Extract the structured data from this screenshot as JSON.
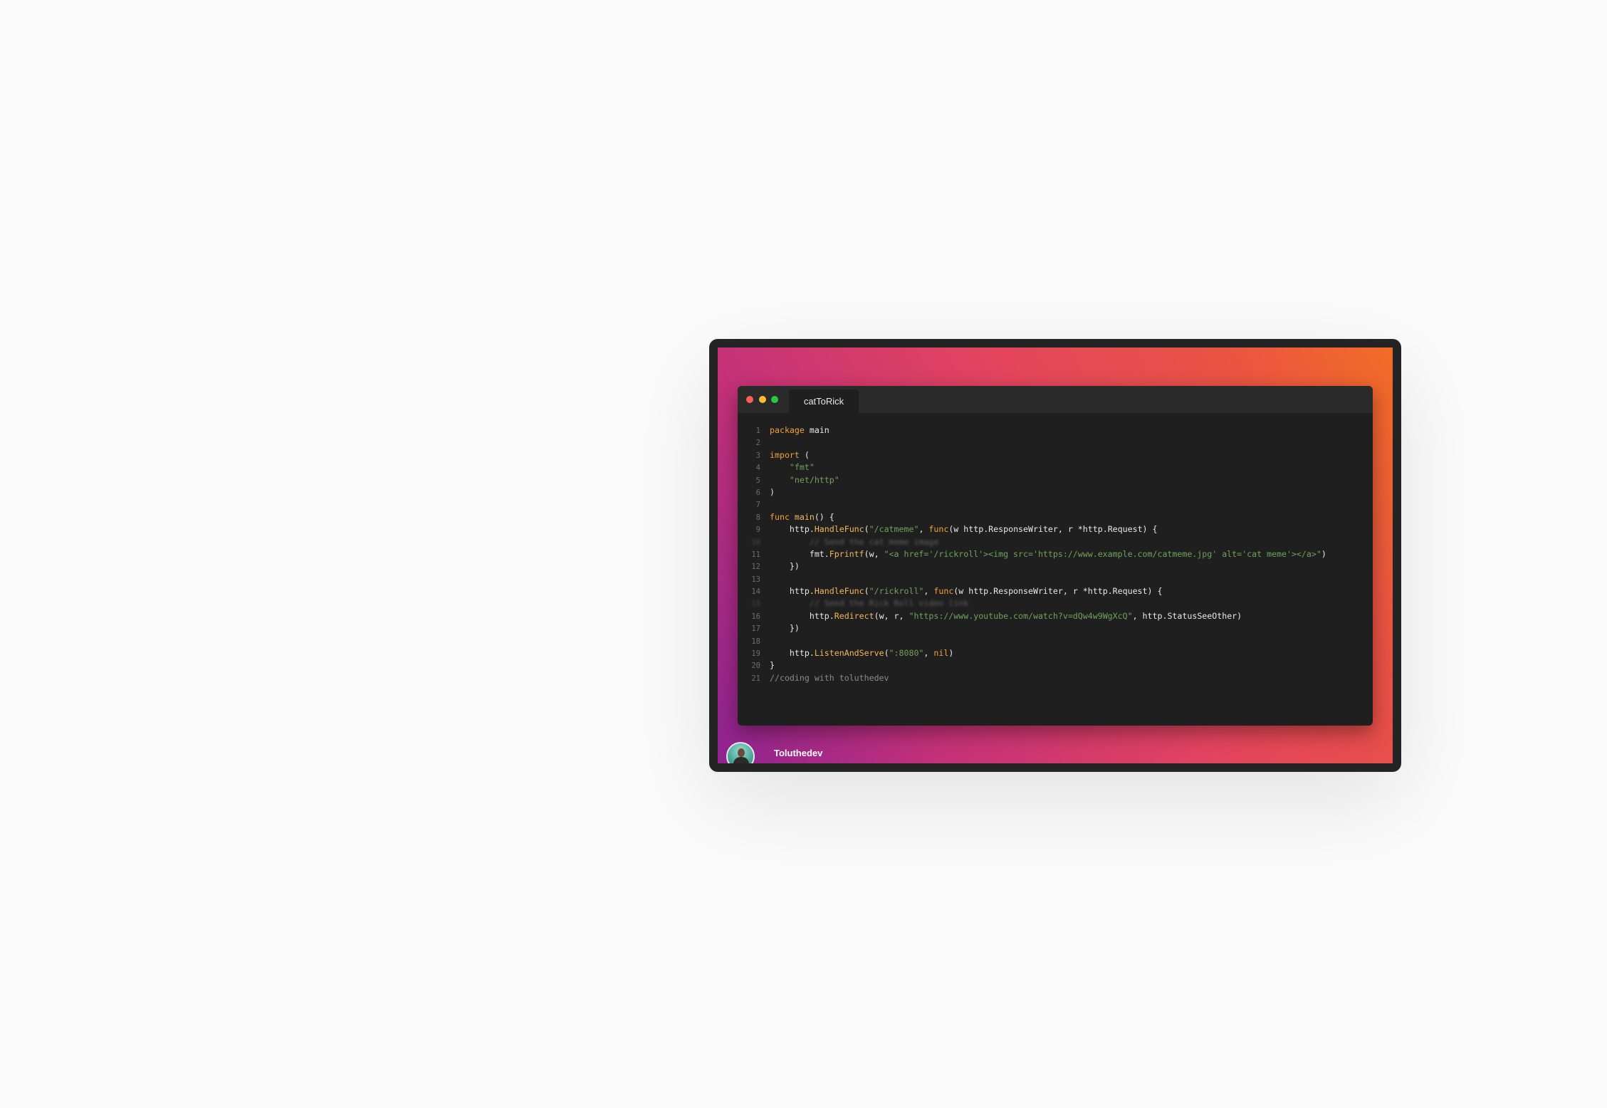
{
  "editor": {
    "tab_title": "catToRick",
    "lines": [
      {
        "n": "1",
        "tokens": [
          {
            "t": "package",
            "c": "kw"
          },
          {
            "t": " main",
            "c": ""
          }
        ]
      },
      {
        "n": "2",
        "tokens": []
      },
      {
        "n": "3",
        "tokens": [
          {
            "t": "import",
            "c": "kw"
          },
          {
            "t": " (",
            "c": ""
          }
        ]
      },
      {
        "n": "4",
        "tokens": [
          {
            "t": "    ",
            "c": ""
          },
          {
            "t": "\"fmt\"",
            "c": "str"
          }
        ]
      },
      {
        "n": "5",
        "tokens": [
          {
            "t": "    ",
            "c": ""
          },
          {
            "t": "\"net/http\"",
            "c": "str"
          }
        ]
      },
      {
        "n": "6",
        "tokens": [
          {
            "t": ")",
            "c": ""
          }
        ]
      },
      {
        "n": "7",
        "tokens": []
      },
      {
        "n": "8",
        "tokens": [
          {
            "t": "func",
            "c": "kw"
          },
          {
            "t": " ",
            "c": ""
          },
          {
            "t": "main",
            "c": "fn"
          },
          {
            "t": "() {",
            "c": ""
          }
        ]
      },
      {
        "n": "9",
        "tokens": [
          {
            "t": "    http.",
            "c": ""
          },
          {
            "t": "HandleFunc",
            "c": "fn"
          },
          {
            "t": "(",
            "c": ""
          },
          {
            "t": "\"/catmeme\"",
            "c": "str"
          },
          {
            "t": ", ",
            "c": ""
          },
          {
            "t": "func",
            "c": "kw"
          },
          {
            "t": "(w http.ResponseWriter, r *http.Request) {",
            "c": ""
          }
        ]
      },
      {
        "n": "10",
        "blur": true,
        "tokens": [
          {
            "t": "        ",
            "c": ""
          },
          {
            "t": "// Send the cat meme image",
            "c": "cm"
          }
        ]
      },
      {
        "n": "11",
        "tokens": [
          {
            "t": "        fmt.",
            "c": ""
          },
          {
            "t": "Fprintf",
            "c": "fn"
          },
          {
            "t": "(w, ",
            "c": ""
          },
          {
            "t": "\"<a href='/rickroll'><img src='https://www.example.com/catmeme.jpg' alt='cat meme'></a>\"",
            "c": "str"
          },
          {
            "t": ")",
            "c": ""
          }
        ]
      },
      {
        "n": "12",
        "tokens": [
          {
            "t": "    })",
            "c": ""
          }
        ]
      },
      {
        "n": "13",
        "tokens": []
      },
      {
        "n": "14",
        "tokens": [
          {
            "t": "    http.",
            "c": ""
          },
          {
            "t": "HandleFunc",
            "c": "fn"
          },
          {
            "t": "(",
            "c": ""
          },
          {
            "t": "\"/rickroll\"",
            "c": "str"
          },
          {
            "t": ", ",
            "c": ""
          },
          {
            "t": "func",
            "c": "kw"
          },
          {
            "t": "(w http.ResponseWriter, r *http.Request) {",
            "c": ""
          }
        ]
      },
      {
        "n": "15",
        "blur": true,
        "tokens": [
          {
            "t": "        ",
            "c": ""
          },
          {
            "t": "// Send the Rick Roll video link",
            "c": "cm"
          }
        ]
      },
      {
        "n": "16",
        "tokens": [
          {
            "t": "        http.",
            "c": ""
          },
          {
            "t": "Redirect",
            "c": "fn"
          },
          {
            "t": "(w, r, ",
            "c": ""
          },
          {
            "t": "\"https://www.youtube.com/watch?v=dQw4w9WgXcQ\"",
            "c": "str"
          },
          {
            "t": ", http.StatusSeeOther)",
            "c": ""
          }
        ]
      },
      {
        "n": "17",
        "tokens": [
          {
            "t": "    })",
            "c": ""
          }
        ]
      },
      {
        "n": "18",
        "tokens": []
      },
      {
        "n": "19",
        "tokens": [
          {
            "t": "    http.",
            "c": ""
          },
          {
            "t": "ListenAndServe",
            "c": "fn"
          },
          {
            "t": "(",
            "c": ""
          },
          {
            "t": "\":8080\"",
            "c": "str"
          },
          {
            "t": ", ",
            "c": ""
          },
          {
            "t": "nil",
            "c": "kw"
          },
          {
            "t": ")",
            "c": ""
          }
        ]
      },
      {
        "n": "20",
        "tokens": [
          {
            "t": "}",
            "c": ""
          }
        ]
      },
      {
        "n": "21",
        "tokens": [
          {
            "t": "//coding with toluthedev",
            "c": "cm"
          }
        ]
      }
    ]
  },
  "author": {
    "name": "Toluthedev"
  },
  "colors": {
    "keyword": "#f0a13a",
    "function": "#f2b85a",
    "string": "#6fa35a",
    "comment": "#8a8a8a",
    "editor_bg": "#1f1f1f"
  }
}
